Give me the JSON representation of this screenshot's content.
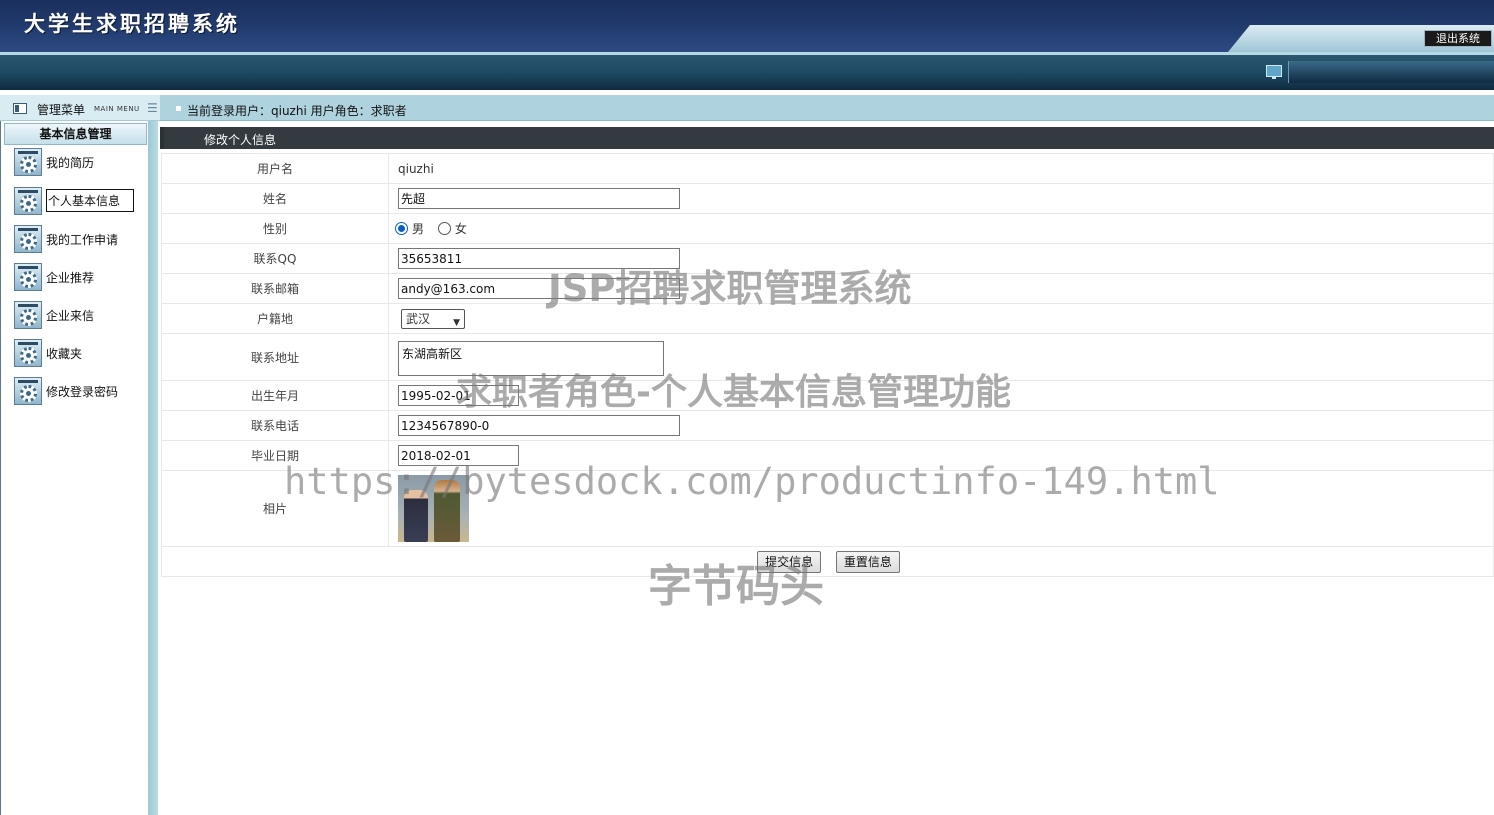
{
  "header": {
    "app_title": "大学生求职招聘系统",
    "logout_label": "退出系统"
  },
  "menu": {
    "title": "管理菜单",
    "subtitle": "MAIN MENU",
    "group_title": "基本信息管理",
    "items": [
      {
        "label": "我的简历",
        "icon": "gear-icon"
      },
      {
        "label": "个人基本信息",
        "icon": "gear-icon",
        "active": true
      },
      {
        "label": "我的工作申请",
        "icon": "gear-icon"
      },
      {
        "label": "企业推荐",
        "icon": "gear-icon"
      },
      {
        "label": "企业来信",
        "icon": "gear-icon"
      },
      {
        "label": "收藏夹",
        "icon": "gear-icon"
      },
      {
        "label": "修改登录密码",
        "icon": "gear-icon"
      }
    ]
  },
  "location": {
    "text": "当前登录用户：qiuzhi  用户角色：求职者"
  },
  "panel": {
    "title": "修改个人信息"
  },
  "form": {
    "username": {
      "label": "用户名",
      "value": "qiuzhi"
    },
    "name": {
      "label": "姓名",
      "value": "先超"
    },
    "gender": {
      "label": "性别",
      "options": [
        "男",
        "女"
      ],
      "selected": "男"
    },
    "qq": {
      "label": "联系QQ",
      "value": "35653811"
    },
    "email": {
      "label": "联系邮箱",
      "value": "andy@163.com"
    },
    "hometown": {
      "label": "户籍地",
      "selected": "武汉"
    },
    "address": {
      "label": "联系地址",
      "value": "东湖高新区"
    },
    "birth": {
      "label": "出生年月",
      "value": "1995-02-01"
    },
    "phone": {
      "label": "联系电话",
      "value": "1234567890-0"
    },
    "graduation": {
      "label": "毕业日期",
      "value": "2018-02-01"
    },
    "photo": {
      "label": "相片"
    },
    "submit_label": "提交信息",
    "reset_label": "重置信息"
  },
  "watermarks": [
    "JSP招聘求职管理系统",
    "求职者角色-个人基本信息管理功能",
    "https://bytesdock.com/productinfo-149.html",
    "字节码头"
  ],
  "colors": {
    "header_bg": "#223c70",
    "panel_header_bg": "#333b40",
    "location_bar_bg": "#aed3de",
    "radio_accent": "#0b5fc4"
  }
}
